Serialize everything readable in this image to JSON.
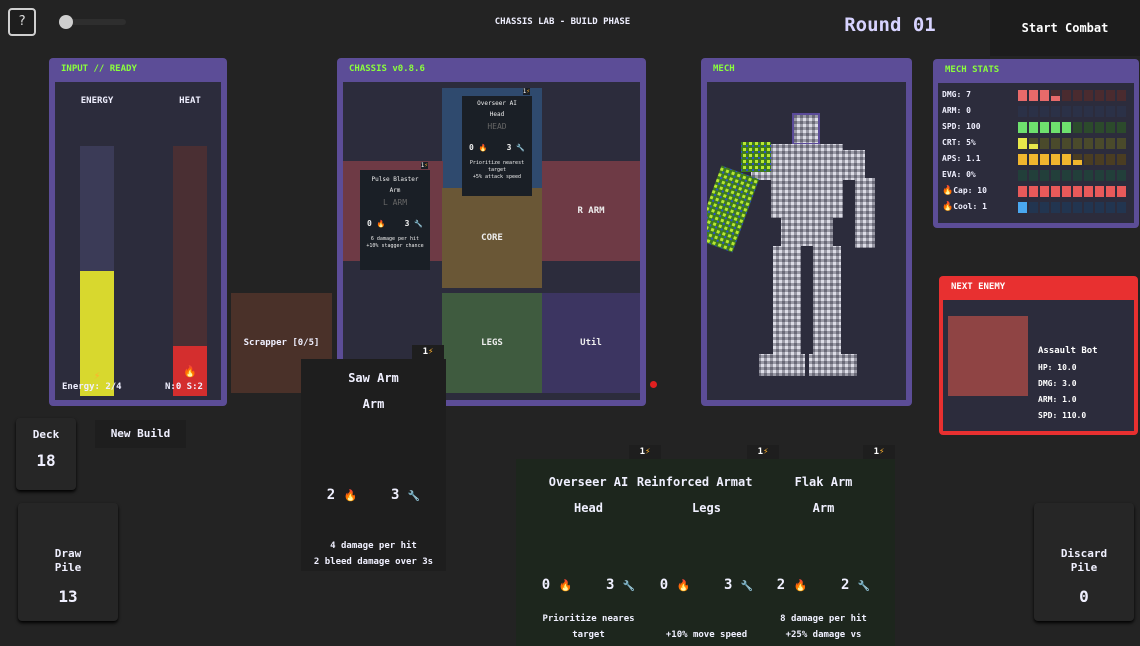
{
  "topbar": {
    "help_label": "?",
    "phase_title": "CHASSIS LAB - BUILD PHASE",
    "round_label": "Round 01",
    "start_combat_label": "Start Combat"
  },
  "input_panel": {
    "title": "INPUT // READY",
    "energy_label": "ENERGY",
    "heat_label": "HEAT",
    "energy_text": "Energy: 2/4",
    "heat_text": "N:0 S:2",
    "energy_fraction": 0.5,
    "heat_fraction": 0.2
  },
  "chassis_panel": {
    "title": "CHASSIS v0.8.6",
    "slots": {
      "head": "HEAD",
      "l_arm": "L ARM",
      "r_arm": "R ARM",
      "core": "CORE",
      "legs": "LEGS",
      "util": "Util"
    },
    "equipped": [
      {
        "cost": "1",
        "title": "Overseer AI",
        "type": "Head",
        "ghost": "HEAD",
        "heat": "0",
        "repair": "3",
        "desc": "Prioritize nearest target\n+5% attack speed"
      },
      {
        "cost": "1",
        "title": "Pulse Blaster",
        "type": "Arm",
        "ghost": "L ARM",
        "heat": "0",
        "repair": "3",
        "desc": "6 damage per hit\n+10% stagger chance"
      }
    ],
    "scrapper_label": "Scrapper [0/5]"
  },
  "mech_panel": {
    "title": "MECH"
  },
  "mech_stats": {
    "title": "MECH STATS",
    "rows": [
      {
        "label": "DMG: 7",
        "filled": 3,
        "partial": 1,
        "color": "#e86a6a",
        "dim": "#4a2b2f"
      },
      {
        "label": "ARM: 0",
        "filled": 0,
        "partial": 0,
        "color": "#5c6cc8",
        "dim": "#2b3147"
      },
      {
        "label": "SPD: 100",
        "filled": 5,
        "partial": 0,
        "color": "#6ee06e",
        "dim": "#2c4a2c"
      },
      {
        "label": "CRT: 5%",
        "filled": 1,
        "partial": 1,
        "color": "#e8e84a",
        "dim": "#4a4a2b"
      },
      {
        "label": "APS: 1.1",
        "filled": 5,
        "partial": 1,
        "color": "#f0b62e",
        "dim": "#4a3d22"
      },
      {
        "label": "EVA: 0%",
        "filled": 0,
        "partial": 0,
        "color": "#3ab89a",
        "dim": "#223f3a"
      },
      {
        "label": "Cap: 10",
        "filled": 10,
        "partial": 0,
        "color": "#e85a5a",
        "dim": "#4a2b2f",
        "icon": "fire"
      },
      {
        "label": "Cool: 1",
        "filled": 1,
        "partial": 0,
        "color": "#4aa8f0",
        "dim": "#223550",
        "icon": "fire"
      }
    ]
  },
  "next_enemy": {
    "title": "NEXT ENEMY",
    "name": "Assault Bot",
    "hp": "HP: 10.0",
    "dmg": "DMG: 3.0",
    "arm": "ARM: 1.0",
    "spd": "SPD: 110.0"
  },
  "deck": {
    "label": "Deck",
    "count": "18"
  },
  "new_build_label": "New Build",
  "draw_pile": {
    "label_line1": "Draw",
    "label_line2": "Pile",
    "count": "13"
  },
  "discard_pile": {
    "label_line1": "Discard",
    "label_line2": "Pile",
    "count": "0"
  },
  "hand": [
    {
      "cost": "1",
      "title": "Saw Arm",
      "type": "Arm",
      "heat": "2",
      "repair": "3",
      "desc1": "4 damage per hit",
      "desc2": "2 bleed damage over 3s"
    },
    {
      "cost": "1",
      "title": "Overseer AI",
      "type": "Head",
      "heat": "0",
      "repair": "3",
      "desc1": "Prioritize neares",
      "desc2": "target"
    },
    {
      "cost": "1",
      "title": "Reinforced Armature",
      "type": "Legs",
      "heat": "0",
      "repair": "3",
      "desc1": "",
      "desc2": "+10% move speed"
    },
    {
      "cost": "1",
      "title": "Flak Arm",
      "type": "Arm",
      "heat": "2",
      "repair": "2",
      "desc1": "8 damage per hit",
      "desc2": "+25% damage vs"
    }
  ],
  "colors": {
    "panel_border": "#5c4d97",
    "panel_title": "#8aff3c",
    "enemy_border": "#e83030",
    "energy": "#d8d82e",
    "heat": "#d42e2e"
  }
}
